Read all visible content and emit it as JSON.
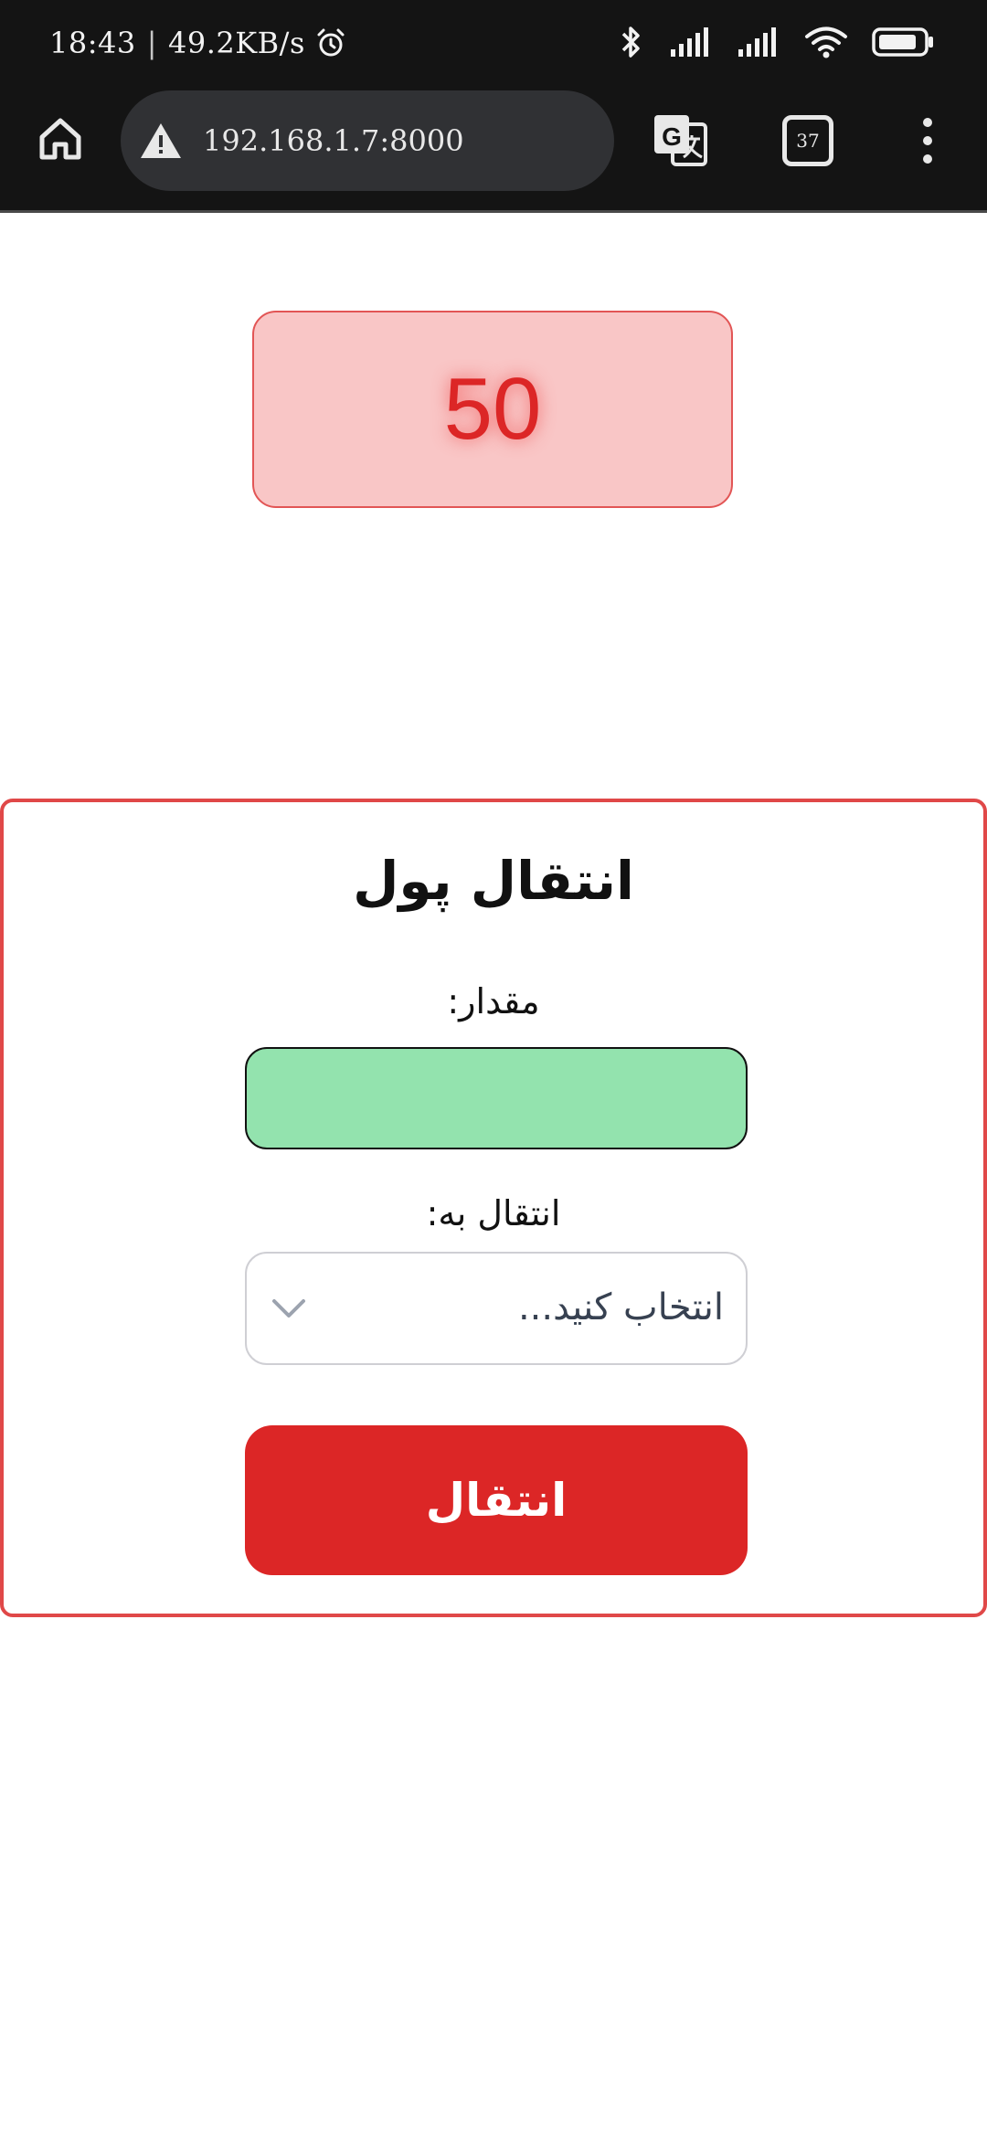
{
  "status_bar": {
    "time": "18:43",
    "separator": "|",
    "network_speed": "49.2KB/s",
    "icons": [
      "alarm-icon",
      "bluetooth-icon",
      "signal-icon",
      "signal-icon",
      "wifi-icon",
      "battery-icon"
    ]
  },
  "browser": {
    "url": "192.168.1.7:8000",
    "tab_count": "37",
    "icons": [
      "home-icon",
      "warning-icon",
      "translate-icon",
      "more-vert-icon"
    ]
  },
  "balance": {
    "value": "50"
  },
  "transfer_form": {
    "title": "انتقال پول",
    "amount_label": "مقدار:",
    "amount_value": "",
    "destination_label": "انتقال به:",
    "destination_placeholder": "انتخاب کنید...",
    "submit_label": "انتقال"
  },
  "colors": {
    "accent_red": "#dc2626",
    "balance_bg": "#f9c6c6",
    "amount_input_bg": "#93e3ae",
    "browser_bar": "#141414"
  }
}
